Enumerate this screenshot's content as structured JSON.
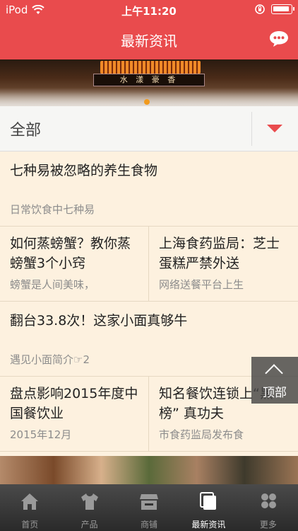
{
  "status_bar": {
    "carrier": "iPod",
    "time": "上午11:20"
  },
  "navbar": {
    "title": "最新资讯",
    "chat_icon": "chat-bubble-icon"
  },
  "banner": {
    "plaque_text": "水 漾 豪 香"
  },
  "filter": {
    "label": "全部",
    "dropdown_icon": "caret-down-icon"
  },
  "news": {
    "item1": {
      "title": "七种易被忽略的养生食物",
      "summary": "日常饮食中七种易"
    },
    "item2": {
      "title": "如何蒸螃蟹？教你蒸螃蟹3个小窍",
      "summary": "螃蟹是人间美味，"
    },
    "item3": {
      "title": "上海食药监局：芝士蛋糕严禁外送",
      "summary": "网络送餐平台上生"
    },
    "item4": {
      "title": "翻台33.8次！这家小面真够牛",
      "summary": "遇见小面简介☞2"
    },
    "item5": {
      "title": "盘点影响2015年度中国餐饮业",
      "summary": "2015年12月"
    },
    "item6": {
      "title": "知名餐饮连锁上“黑榜” 真功夫",
      "summary": "市食药监局发布食"
    }
  },
  "back_to_top": {
    "label": "顶部"
  },
  "tabbar": {
    "tabs": [
      {
        "label": "首页",
        "icon": "home-icon"
      },
      {
        "label": "产品",
        "icon": "shirt-icon"
      },
      {
        "label": "商铺",
        "icon": "store-icon"
      },
      {
        "label": "最新资讯",
        "icon": "news-icon"
      },
      {
        "label": "更多",
        "icon": "more-grid-icon"
      }
    ],
    "active_index": 3
  },
  "colors": {
    "brand_red": "#e94b4d",
    "list_bg": "#fdf1df"
  }
}
